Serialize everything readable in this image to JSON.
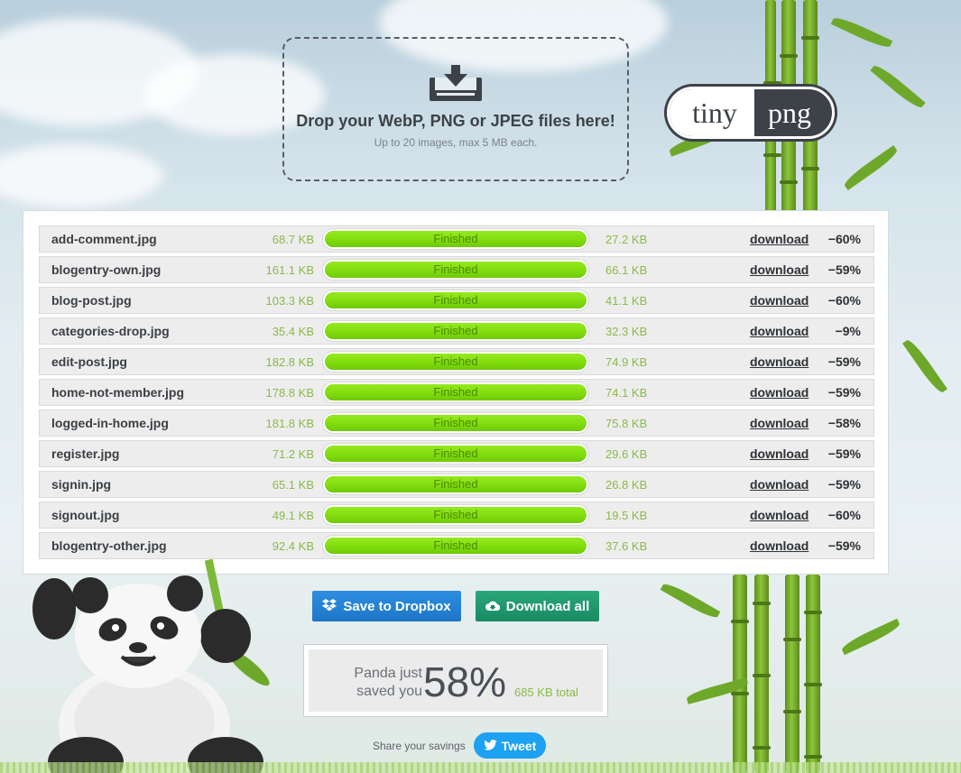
{
  "dropzone": {
    "title": "Drop your WebP, PNG or JPEG files here!",
    "subtitle": "Up to 20 images, max 5 MB each."
  },
  "logo": {
    "left": "tiny",
    "right": "png"
  },
  "files": [
    {
      "name": "add-comment.jpg",
      "original": "68.7 KB",
      "status": "Finished",
      "compressed": "27.2 KB",
      "link": "download",
      "saving": "−60%"
    },
    {
      "name": "blogentry-own.jpg",
      "original": "161.1 KB",
      "status": "Finished",
      "compressed": "66.1 KB",
      "link": "download",
      "saving": "−59%"
    },
    {
      "name": "blog-post.jpg",
      "original": "103.3 KB",
      "status": "Finished",
      "compressed": "41.1 KB",
      "link": "download",
      "saving": "−60%"
    },
    {
      "name": "categories-drop.jpg",
      "original": "35.4 KB",
      "status": "Finished",
      "compressed": "32.3 KB",
      "link": "download",
      "saving": "−9%"
    },
    {
      "name": "edit-post.jpg",
      "original": "182.8 KB",
      "status": "Finished",
      "compressed": "74.9 KB",
      "link": "download",
      "saving": "−59%"
    },
    {
      "name": "home-not-member.jpg",
      "original": "178.8 KB",
      "status": "Finished",
      "compressed": "74.1 KB",
      "link": "download",
      "saving": "−59%"
    },
    {
      "name": "logged-in-home.jpg",
      "original": "181.8 KB",
      "status": "Finished",
      "compressed": "75.8 KB",
      "link": "download",
      "saving": "−58%"
    },
    {
      "name": "register.jpg",
      "original": "71.2 KB",
      "status": "Finished",
      "compressed": "29.6 KB",
      "link": "download",
      "saving": "−59%"
    },
    {
      "name": "signin.jpg",
      "original": "65.1 KB",
      "status": "Finished",
      "compressed": "26.8 KB",
      "link": "download",
      "saving": "−59%"
    },
    {
      "name": "signout.jpg",
      "original": "49.1 KB",
      "status": "Finished",
      "compressed": "19.5 KB",
      "link": "download",
      "saving": "−60%"
    },
    {
      "name": "blogentry-other.jpg",
      "original": "92.4 KB",
      "status": "Finished",
      "compressed": "37.6 KB",
      "link": "download",
      "saving": "−59%"
    }
  ],
  "actions": {
    "dropbox_label": "Save to Dropbox",
    "download_all_label": "Download all"
  },
  "savings": {
    "line1": "Panda just",
    "line2": "saved you",
    "percent": "58%",
    "total": "685 KB total"
  },
  "share": {
    "label": "Share your savings",
    "tweet_label": "Tweet"
  },
  "colors": {
    "progress": "#7fdb0c",
    "size_text": "#8aba4a",
    "dropbox": "#1e76c7",
    "download_all": "#198a62",
    "tweet": "#1da1f2"
  },
  "icons": [
    "download-tray-icon",
    "dropbox-icon",
    "cloud-download-icon",
    "twitter-bird-icon",
    "panda-mascot",
    "bamboo-decoration"
  ]
}
